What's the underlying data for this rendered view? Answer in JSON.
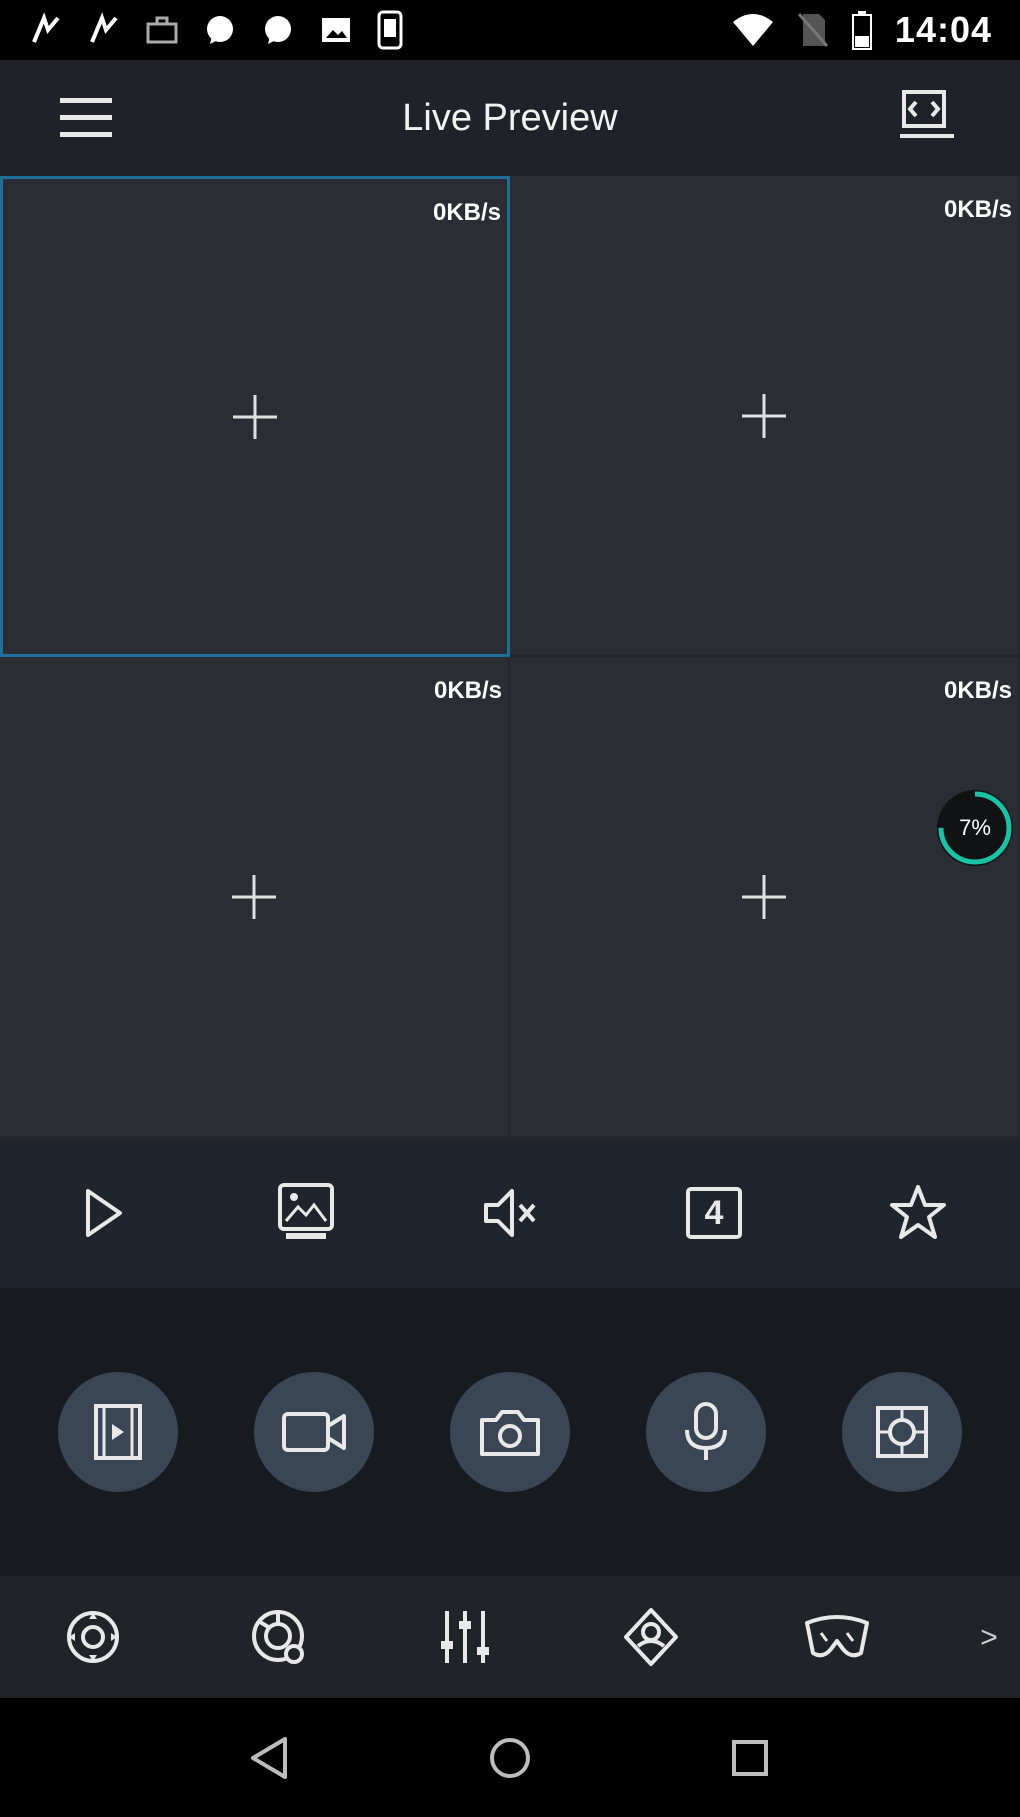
{
  "status_bar": {
    "time": "14:04",
    "icons": [
      "notification-icon",
      "notification-icon",
      "briefcase-icon",
      "chat-icon",
      "chat-icon",
      "image-icon",
      "phone-icon",
      "wifi-icon",
      "no-sim-icon",
      "battery-icon"
    ]
  },
  "app_bar": {
    "title": "Live Preview",
    "menu_icon": "hamburger-menu-icon",
    "layout_icon": "layout-switch-icon"
  },
  "grid": {
    "cells": [
      {
        "rate": "0KB/s",
        "selected": true
      },
      {
        "rate": "0KB/s",
        "selected": false
      },
      {
        "rate": "0KB/s",
        "selected": false
      },
      {
        "rate": "0KB/s",
        "selected": false
      }
    ],
    "progress": {
      "label": "7%",
      "value": 0.75,
      "color": "#17c3a3"
    }
  },
  "toolbar": {
    "items": [
      "play-icon",
      "image-quality-icon",
      "mute-icon",
      "split-4-icon",
      "favorite-star-icon"
    ],
    "split_label": "4"
  },
  "actions": {
    "items": [
      "playback-icon",
      "record-icon",
      "snapshot-icon",
      "talk-mic-icon",
      "fisheye-icon"
    ]
  },
  "controls": {
    "items": [
      "ptz-icon",
      "color-adjust-icon",
      "equalizer-icon",
      "alarm-icon",
      "vr-icon"
    ],
    "more": ">"
  },
  "nav_bar": {
    "items": [
      "back-icon",
      "home-icon",
      "recent-apps-icon"
    ]
  },
  "colors": {
    "selected_border": "#1f6f9a",
    "progress": "#17c3a3",
    "circle_button": "#3a4656"
  }
}
